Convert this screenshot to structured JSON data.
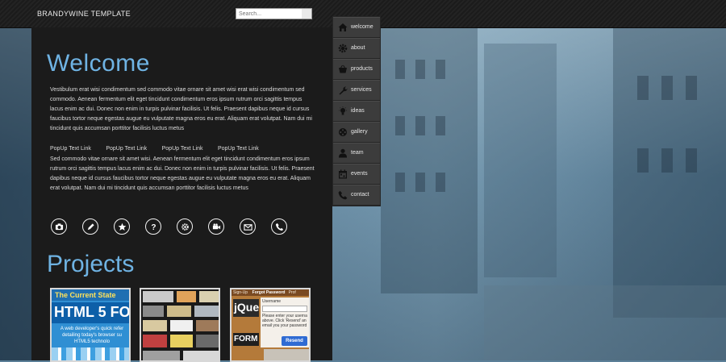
{
  "header": {
    "brand": "BRANDYWINE TEMPLATE",
    "search_placeholder": "Search..."
  },
  "main": {
    "welcome_title": "Welcome",
    "paragraph_1": "Vestibulum erat wisi condimentum sed commodo vitae ornare sit amet wisi erat wisi condimentum sed commodo. Aenean fermentum elit eget tincidunt condimentum eros ipsum rutrum orci sagittis tempus lacus enim ac dui. Donec non enim in turpis pulvinar facilisis. Ut felis. Praesent dapibus neque id cursus faucibus tortor neque egestas augue eu vulputate magna eros eu erat. Aliquam erat volutpat. Nam dui mi tincidunt quis accumsan porttitor facilisis luctus metus",
    "popup_links": [
      "PopUp Text Link",
      "PopUp Text Link",
      "PopUp Text Link",
      "PopUp Text Link"
    ],
    "paragraph_2": "Sed commodo vitae ornare sit amet wisi. Aenean fermentum elit eget tincidunt condimentum eros ipsum rutrum orci sagittis tempus lacus enim ac dui. Donec non enim in turpis pulvinar facilisis. Ut felis. Praesent dapibus neque id cursus faucibus tortor neque egestas augue eu vulputate magna eros eu erat. Aliquam erat volutpat. Nam dui mi tincidunt quis accumsan porttitor facilisis luctus metus",
    "social_icons": [
      "camera-icon",
      "pencil-icon",
      "star-icon",
      "question-icon",
      "gear-icon",
      "video-camera-icon",
      "mail-icon",
      "phone-icon"
    ],
    "projects_title": "Projects",
    "projects": [
      {
        "heading": "The Current State",
        "big": "HTML 5 FO",
        "text": "A web developer's quick refer detailing today's browser su HTML5 technolo"
      },
      {
        "heading": "",
        "big": "",
        "text": ""
      },
      {
        "tabs": [
          "Sign-Up",
          "Forgot Password",
          "Prof"
        ],
        "badge": "jQue",
        "label": "Username",
        "copy": "Please enter your userna above. Click 'Resend' an email you your password",
        "badge2": "FORM",
        "button": "Resend"
      }
    ]
  },
  "nav": {
    "items": [
      {
        "label": "welcome",
        "icon": "home-icon"
      },
      {
        "label": "about",
        "icon": "gear-icon"
      },
      {
        "label": "products",
        "icon": "basket-icon"
      },
      {
        "label": "services",
        "icon": "wrench-icon"
      },
      {
        "label": "ideas",
        "icon": "lightbulb-icon"
      },
      {
        "label": "gallery",
        "icon": "film-reel-icon"
      },
      {
        "label": "team",
        "icon": "person-icon"
      },
      {
        "label": "events",
        "icon": "calendar-icon"
      },
      {
        "label": "contact",
        "icon": "phone-icon"
      }
    ]
  },
  "colors": {
    "accent": "#6fb3e3",
    "panel": "#1b1b1b",
    "header": "#1d1d1d"
  }
}
